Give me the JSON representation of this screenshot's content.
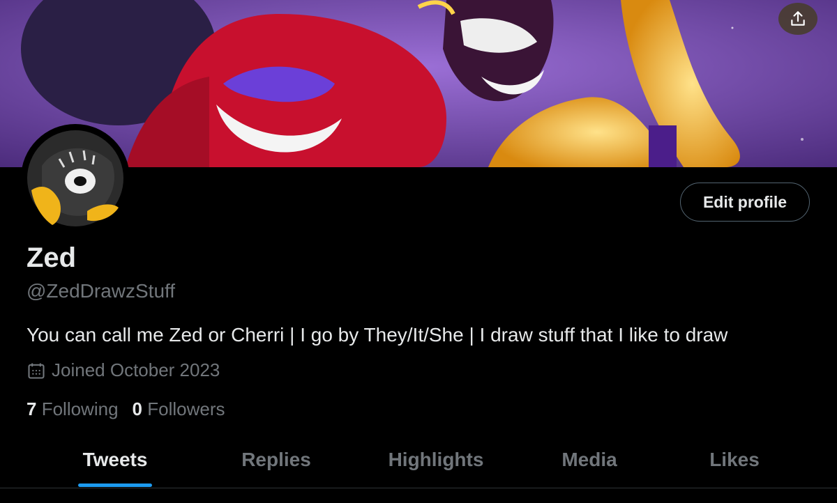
{
  "header": {
    "share_icon": "share-upload-icon"
  },
  "profile": {
    "name": "Zed",
    "handle": "@ZedDrawzStuff",
    "bio": "You can call me Zed or Cherri | I go by They/It/She | I draw stuff that I like to draw",
    "joined": "Joined October 2023",
    "joined_icon": "calendar-icon",
    "following_count": "7",
    "following_label": "Following",
    "followers_count": "0",
    "followers_label": "Followers",
    "edit_label": "Edit profile"
  },
  "tabs": [
    {
      "label": "Tweets",
      "active": true
    },
    {
      "label": "Replies",
      "active": false
    },
    {
      "label": "Highlights",
      "active": false
    },
    {
      "label": "Media",
      "active": false
    },
    {
      "label": "Likes",
      "active": false
    }
  ],
  "colors": {
    "background": "#000000",
    "text_primary": "#e7e9ea",
    "text_secondary": "#71767b",
    "accent": "#1d9bf0"
  }
}
